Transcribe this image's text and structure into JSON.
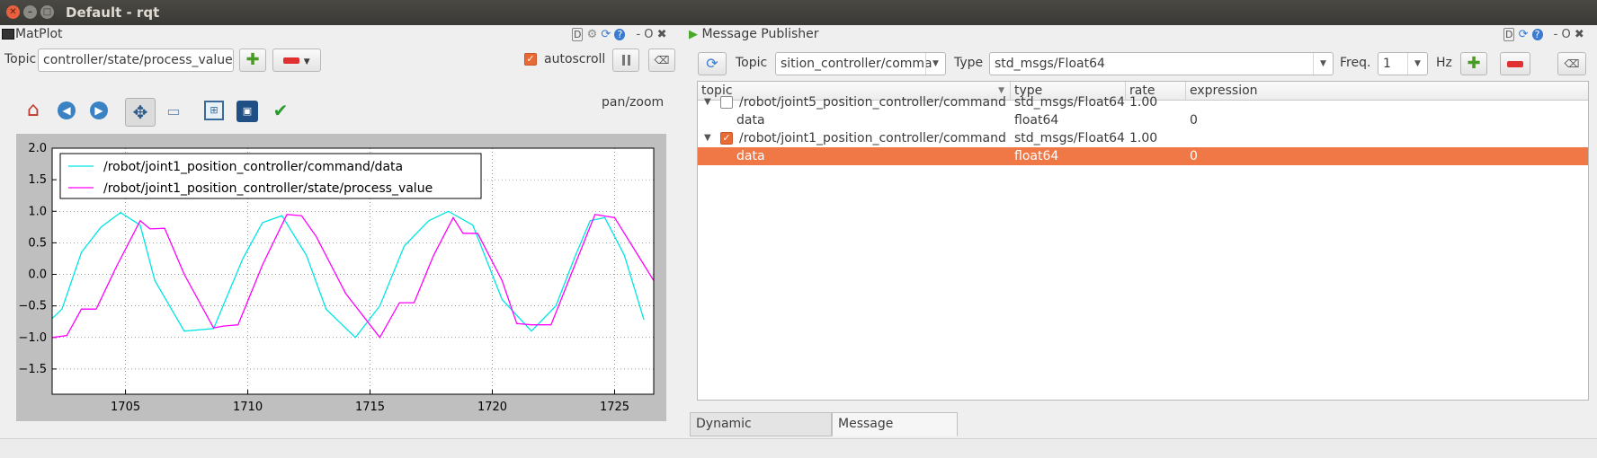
{
  "window": {
    "title": "Default - rqt"
  },
  "matplot": {
    "dock_title": "MatPlot",
    "topic_label": "Topic",
    "topic_value": "controller/state/process_value",
    "autoscroll_label": "autoscroll",
    "autoscroll_checked": true,
    "mode_text": "pan/zoom",
    "hdr_buttons": "D",
    "close_glyphs": "- O ✖"
  },
  "chart_data": {
    "type": "line",
    "title": "",
    "xlabel": "",
    "ylabel": "",
    "xlim": [
      1702.0,
      1726.6
    ],
    "ylim": [
      -1.9,
      2.0
    ],
    "xticks": [
      "1705",
      "1710",
      "1715",
      "1720",
      "1725"
    ],
    "yticks": [
      "2.0",
      "1.5",
      "1.0",
      "0.5",
      "0.0",
      "−0.5",
      "−1.0",
      "−1.5"
    ],
    "grid": true,
    "legend_position": "upper-left",
    "series": [
      {
        "name": "/robot/joint1_position_controller/command/data",
        "color": "#00e5e5",
        "x": [
          1702.0,
          1702.4,
          1703.2,
          1704.0,
          1704.8,
          1705.6,
          1706.2,
          1707.4,
          1708.6,
          1709.8,
          1710.6,
          1711.4,
          1712.4,
          1713.2,
          1714.4,
          1715.4,
          1716.4,
          1717.4,
          1718.2,
          1719.2,
          1720.4,
          1721.6,
          1722.6,
          1723.4,
          1724.0,
          1724.6,
          1725.4,
          1726.2
        ],
        "y": [
          -0.7,
          -0.55,
          0.35,
          0.75,
          0.98,
          0.78,
          -0.1,
          -0.9,
          -0.86,
          0.25,
          0.82,
          0.93,
          0.3,
          -0.55,
          -1.0,
          -0.5,
          0.45,
          0.85,
          1.0,
          0.78,
          -0.4,
          -0.9,
          -0.5,
          0.3,
          0.85,
          0.9,
          0.3,
          -0.72
        ]
      },
      {
        "name": "/robot/joint1_position_controller/state/process_value",
        "color": "#ff00ff",
        "x": [
          1702.0,
          1702.6,
          1703.2,
          1703.8,
          1704.6,
          1705.6,
          1706.0,
          1706.6,
          1707.4,
          1708.6,
          1709.0,
          1709.6,
          1710.6,
          1711.6,
          1712.2,
          1712.8,
          1714.0,
          1715.4,
          1716.2,
          1716.8,
          1717.6,
          1718.4,
          1718.8,
          1719.4,
          1720.4,
          1721.0,
          1721.6,
          1722.4,
          1724.2,
          1725.0,
          1726.6
        ],
        "y": [
          -1.0,
          -0.97,
          -0.55,
          -0.55,
          0.1,
          0.85,
          0.72,
          0.73,
          0.0,
          -0.85,
          -0.82,
          -0.8,
          0.15,
          0.95,
          0.93,
          0.6,
          -0.3,
          -1.0,
          -0.45,
          -0.45,
          0.3,
          0.9,
          0.65,
          0.65,
          -0.1,
          -0.78,
          -0.8,
          -0.8,
          0.95,
          0.9,
          -0.1
        ]
      }
    ]
  },
  "publisher": {
    "dock_title": "Message Publisher",
    "topic_label": "Topic",
    "topic_value": "sition_controller/comma",
    "type_label": "Type",
    "type_value": "std_msgs/Float64",
    "freq_label": "Freq.",
    "freq_value": "1",
    "hz_label": "Hz",
    "hdr_buttons": "D",
    "close_glyphs": "- O ✖",
    "columns": [
      "topic",
      "type",
      "rate",
      "expression"
    ],
    "rows": [
      {
        "expander": "▼",
        "checked": false,
        "topic": "/robot/joint5_position_controller/command",
        "type": "std_msgs/Float64",
        "rate": "1.00",
        "expression": ""
      },
      {
        "expander": "",
        "checked": null,
        "topic": "data",
        "type": "float64",
        "rate": "",
        "expression": "0"
      },
      {
        "expander": "▼",
        "checked": true,
        "topic": "/robot/joint1_position_controller/command",
        "type": "std_msgs/Float64",
        "rate": "1.00",
        "expression": ""
      },
      {
        "expander": "",
        "checked": null,
        "topic": "data",
        "type": "float64",
        "rate": "",
        "expression": "0"
      }
    ]
  },
  "tabs": [
    "Dynamic Reconfigure",
    "Message Publisher"
  ],
  "active_tab": "Message Publisher"
}
